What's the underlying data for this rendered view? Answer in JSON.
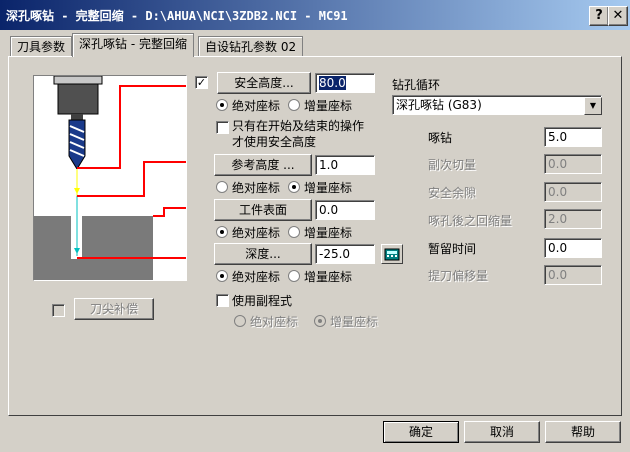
{
  "window": {
    "title": "深孔啄钻 - 完整回缩 - D:\\AHUA\\NCI\\3ZDB2.NCI - MC91",
    "help_glyph": "?",
    "close_glyph": "✕"
  },
  "tabs": [
    {
      "label": "刀具参数"
    },
    {
      "label": "深孔啄钻 - 完整回缩"
    },
    {
      "label": "自设钻孔参数 02"
    }
  ],
  "left_panel": {
    "tip_comp_label": "刀尖补偿",
    "colors": {
      "background": "#ffffff",
      "stock": "#7a7a7a",
      "tool_body": "#505050",
      "level_lines": "#ff0000"
    }
  },
  "clearance": {
    "checked": true,
    "check_glyph": "✓",
    "button_label": "安全高度...",
    "value": "80.0",
    "abs_label": "绝对座标",
    "inc_label": "增量座标",
    "mode": "absolute"
  },
  "clearance_option": {
    "label_line1": "只有在开始及结束的操作",
    "label_line2": "才使用安全高度",
    "checked": false
  },
  "retract": {
    "button_label": "参考高度 ...",
    "value": "1.0",
    "abs_label": "绝对座标",
    "inc_label": "增量座标",
    "mode": "incremental"
  },
  "top_of_stock": {
    "button_label": "工件表面",
    "value": "0.0",
    "abs_label": "绝对座标",
    "inc_label": "增量座标",
    "mode": "absolute"
  },
  "depth": {
    "button_label": "深度...",
    "value": "-25.0",
    "abs_label": "绝对座标",
    "inc_label": "增量座标",
    "mode": "absolute"
  },
  "subprogram": {
    "label": "使用副程式",
    "checked": false,
    "abs_label": "绝对座标",
    "inc_label": "增量座标",
    "mode": "incremental"
  },
  "cycle": {
    "header": "钻孔循环",
    "selected": "深孔啄钻 (G83)",
    "params": [
      {
        "label": "啄钻",
        "value": "5.0",
        "enabled": true
      },
      {
        "label": "副次切量",
        "value": "0.0",
        "enabled": false
      },
      {
        "label": "安全余隙",
        "value": "0.0",
        "enabled": false
      },
      {
        "label": "啄孔後之回缩量",
        "value": "2.0",
        "enabled": false
      },
      {
        "label": "暂留时间",
        "value": "0.0",
        "enabled": true
      },
      {
        "label": "提刀偏移量",
        "value": "0.0",
        "enabled": false
      }
    ]
  },
  "footer": {
    "ok_label": "确定",
    "cancel_label": "取消",
    "help_label": "帮助"
  }
}
